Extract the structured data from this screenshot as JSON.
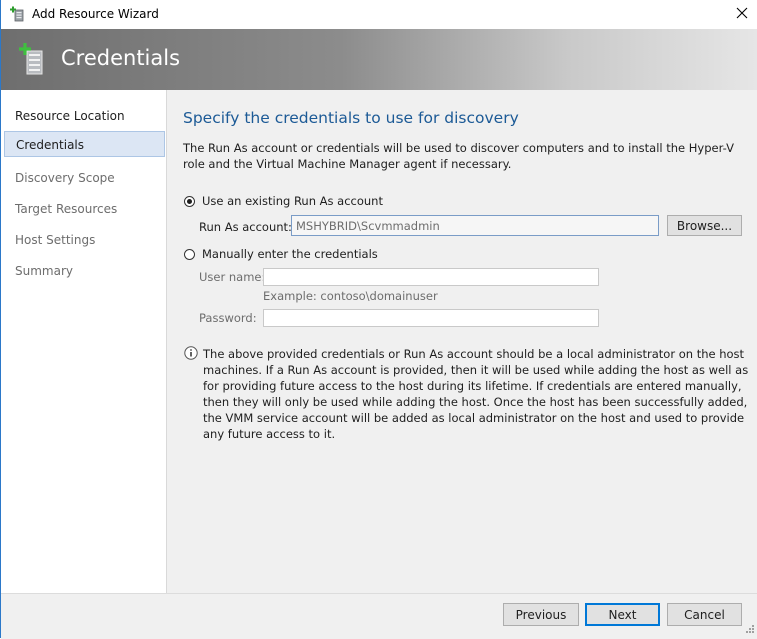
{
  "window": {
    "title": "Add Resource Wizard"
  },
  "header": {
    "title": "Credentials"
  },
  "sidebar": {
    "items": [
      {
        "label": "Resource Location"
      },
      {
        "label": "Credentials"
      },
      {
        "label": "Discovery Scope"
      },
      {
        "label": "Target Resources"
      },
      {
        "label": "Host Settings"
      },
      {
        "label": "Summary"
      }
    ],
    "selected": "Credentials"
  },
  "main": {
    "heading": "Specify the credentials to use for discovery",
    "intro": "The Run As account or credentials will be used to discover computers and to install the Hyper-V role and the Virtual Machine Manager agent if necessary.",
    "option_existing": {
      "label": "Use an existing Run As account",
      "selected": true
    },
    "run_as_label": "Run As account:",
    "run_as_value": "MSHYBRID\\Scvmmadmin",
    "browse_label": "Browse...",
    "option_manual": {
      "label": "Manually enter the credentials",
      "selected": false
    },
    "username_label": "User name:",
    "username_value": "",
    "username_example": "Example: contoso\\domainuser",
    "password_label": "Password:",
    "password_value": "",
    "info_text": "The above provided credentials or Run As account should be a local administrator on the host machines. If a Run As account is provided, then it will be used while adding the host as well as for providing future access to the host during its lifetime. If credentials are entered manually, then they will only be used while adding the host. Once the host has been successfully added, the VMM service account will be added as local administrator on the host and used to provide any future access to it."
  },
  "footer": {
    "previous_label": "Previous",
    "next_label": "Next",
    "cancel_label": "Cancel"
  },
  "icons": {
    "app": "add-resource-icon",
    "banner": "server-add-icon",
    "close": "close-icon",
    "info": "info-icon"
  },
  "colors": {
    "heading": "#1c5a96",
    "selected_nav": "#dce6f4",
    "accent": "#0078d7"
  }
}
